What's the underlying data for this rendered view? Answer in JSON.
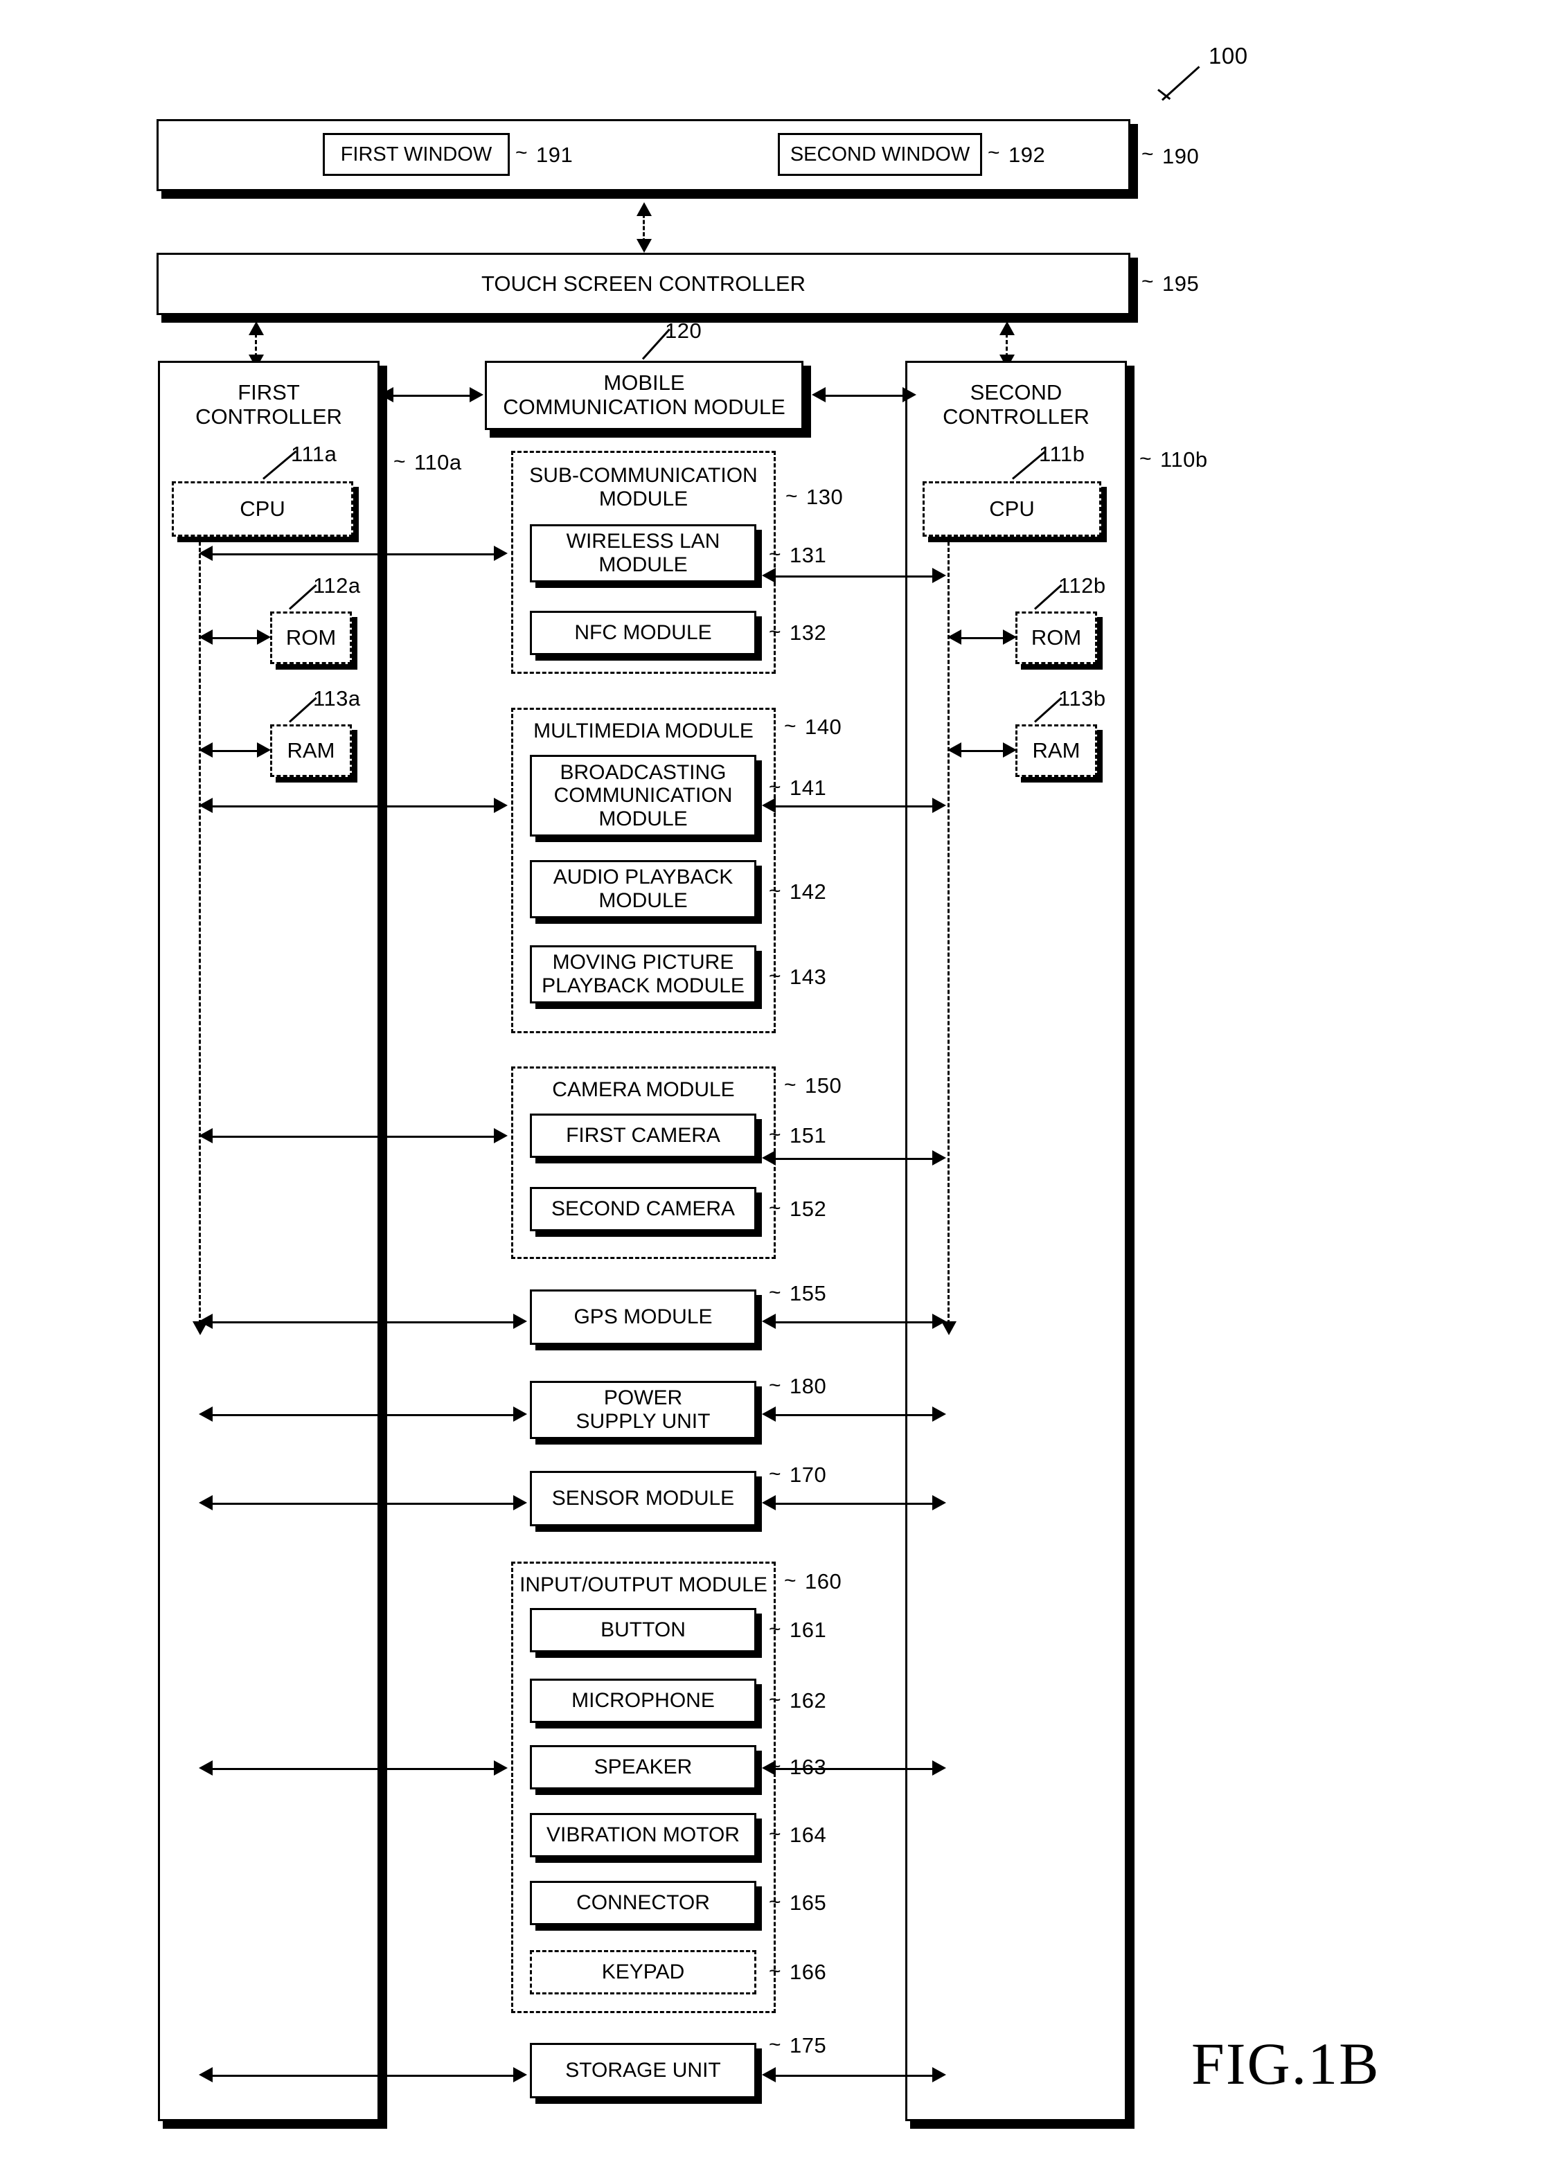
{
  "figure": {
    "label": "FIG.1B",
    "device_ref": "100"
  },
  "display": {
    "ref": "190",
    "first_window": {
      "label": "FIRST WINDOW",
      "ref": "191"
    },
    "second_window": {
      "label": "SECOND WINDOW",
      "ref": "192"
    }
  },
  "touch_screen_controller": {
    "label": "TOUCH SCREEN CONTROLLER",
    "ref": "195"
  },
  "first_controller": {
    "label": "FIRST\nCONTROLLER",
    "ref": "110a",
    "cpu": {
      "label": "CPU",
      "ref": "111a"
    },
    "rom": {
      "label": "ROM",
      "ref": "112a"
    },
    "ram": {
      "label": "RAM",
      "ref": "113a"
    }
  },
  "second_controller": {
    "label": "SECOND\nCONTROLLER",
    "ref": "110b",
    "cpu": {
      "label": "CPU",
      "ref": "111b"
    },
    "rom": {
      "label": "ROM",
      "ref": "112b"
    },
    "ram": {
      "label": "RAM",
      "ref": "113b"
    }
  },
  "mobile_communication_module": {
    "label": "MOBILE\nCOMMUNICATION MODULE",
    "ref": "120"
  },
  "sub_communication_module": {
    "label": "SUB-COMMUNICATION\nMODULE",
    "ref": "130",
    "children": [
      {
        "label": "WIRELESS LAN\nMODULE",
        "ref": "131"
      },
      {
        "label": "NFC MODULE",
        "ref": "132"
      }
    ]
  },
  "multimedia_module": {
    "label": "MULTIMEDIA MODULE",
    "ref": "140",
    "children": [
      {
        "label": "BROADCASTING\nCOMMUNICATION\nMODULE",
        "ref": "141"
      },
      {
        "label": "AUDIO PLAYBACK\nMODULE",
        "ref": "142"
      },
      {
        "label": "MOVING PICTURE\nPLAYBACK MODULE",
        "ref": "143"
      }
    ]
  },
  "camera_module": {
    "label": "CAMERA MODULE",
    "ref": "150",
    "children": [
      {
        "label": "FIRST CAMERA",
        "ref": "151"
      },
      {
        "label": "SECOND CAMERA",
        "ref": "152"
      }
    ]
  },
  "gps_module": {
    "label": "GPS MODULE",
    "ref": "155"
  },
  "power_supply_unit": {
    "label": "POWER\nSUPPLY UNIT",
    "ref": "180"
  },
  "sensor_module": {
    "label": "SENSOR MODULE",
    "ref": "170"
  },
  "input_output_module": {
    "label": "INPUT/OUTPUT MODULE",
    "ref": "160",
    "children": [
      {
        "label": "BUTTON",
        "ref": "161"
      },
      {
        "label": "MICROPHONE",
        "ref": "162"
      },
      {
        "label": "SPEAKER",
        "ref": "163"
      },
      {
        "label": "VIBRATION MOTOR",
        "ref": "164"
      },
      {
        "label": "CONNECTOR",
        "ref": "165"
      },
      {
        "label": "KEYPAD",
        "ref": "166"
      }
    ]
  },
  "storage_unit": {
    "label": "STORAGE UNIT",
    "ref": "175"
  }
}
